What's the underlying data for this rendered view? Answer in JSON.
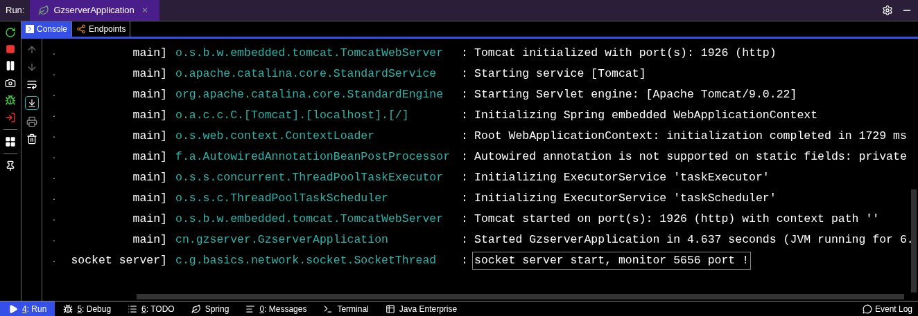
{
  "run_bar": {
    "label": "Run:",
    "tab": {
      "title": "GzserverApplication",
      "close": "✕",
      "selected": true
    }
  },
  "sub_tabs": [
    {
      "label": "Console",
      "selected": true
    },
    {
      "label": "Endpoints",
      "selected": false
    }
  ],
  "log": [
    {
      "mark": ".",
      "thread": "main]",
      "logger": "o.s.b.w.embedded.tomcat.TomcatWebServer",
      "sep": ":",
      "message": "Tomcat initialized with port(s): 1926 (http)",
      "highlighted": false
    },
    {
      "mark": ".",
      "thread": "main]",
      "logger": "o.apache.catalina.core.StandardService",
      "sep": ":",
      "message": "Starting service [Tomcat]",
      "highlighted": false
    },
    {
      "mark": ".",
      "thread": "main]",
      "logger": "org.apache.catalina.core.StandardEngine",
      "sep": ":",
      "message": "Starting Servlet engine: [Apache Tomcat/9.0.22]",
      "highlighted": false
    },
    {
      "mark": ".",
      "thread": "main]",
      "logger": "o.a.c.c.C.[Tomcat].[localhost].[/]",
      "sep": ":",
      "message": "Initializing Spring embedded WebApplicationContext",
      "highlighted": false
    },
    {
      "mark": ".",
      "thread": "main]",
      "logger": "o.s.web.context.ContextLoader",
      "sep": ":",
      "message": "Root WebApplicationContext: initialization completed in 1729 ms",
      "highlighted": false
    },
    {
      "mark": ".",
      "thread": "main]",
      "logger": "f.a.AutowiredAnnotationBeanPostProcessor",
      "sep": ":",
      "message": "Autowired annotation is not supported on static fields: private",
      "highlighted": false
    },
    {
      "mark": ".",
      "thread": "main]",
      "logger": "o.s.s.concurrent.ThreadPoolTaskExecutor",
      "sep": ":",
      "message": "Initializing ExecutorService 'taskExecutor'",
      "highlighted": false
    },
    {
      "mark": ".",
      "thread": "main]",
      "logger": "o.s.s.c.ThreadPoolTaskScheduler",
      "sep": ":",
      "message": "Initializing ExecutorService 'taskScheduler'",
      "highlighted": false
    },
    {
      "mark": ".",
      "thread": "main]",
      "logger": "o.s.b.w.embedded.tomcat.TomcatWebServer",
      "sep": ":",
      "message": "Tomcat started on port(s): 1926 (http) with context path ''",
      "highlighted": false
    },
    {
      "mark": ".",
      "thread": "main]",
      "logger": "cn.gzserver.GzserverApplication",
      "sep": ":",
      "message": "Started GzserverApplication in 4.637 seconds (JVM running for 6.",
      "highlighted": false
    },
    {
      "mark": ".",
      "thread": "socket server]",
      "logger": "c.g.basics.network.socket.SocketThread",
      "sep": ":",
      "message": "socket server start, monitor 5656 port !",
      "highlighted": true
    }
  ],
  "bottom_tabs": [
    {
      "kind": "run",
      "key": "4",
      "label": ": Run",
      "selected": true
    },
    {
      "kind": "debug",
      "key": "5",
      "label": ": Debug",
      "selected": false
    },
    {
      "kind": "todo",
      "key": "6",
      "label": ": TODO",
      "selected": false
    },
    {
      "kind": "spring",
      "label": "Spring",
      "selected": false
    },
    {
      "kind": "messages",
      "key": "0",
      "label": ": Messages",
      "selected": false
    },
    {
      "kind": "terminal",
      "label": "Terminal",
      "selected": false
    },
    {
      "kind": "javaee",
      "label": "Java Enterprise",
      "selected": false
    }
  ],
  "event_log": "Event Log"
}
